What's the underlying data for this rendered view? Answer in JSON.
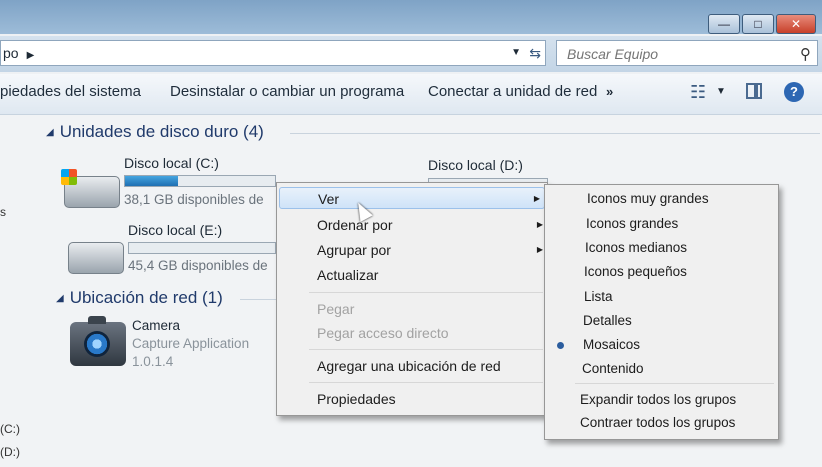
{
  "breadcrumb": {
    "text": "po"
  },
  "search": {
    "placeholder": "Buscar Equipo"
  },
  "toolbar": {
    "items": [
      "piedades del sistema",
      "Desinstalar o cambiar un programa",
      "Conectar a unidad de red"
    ],
    "more": "»"
  },
  "window_buttons": {
    "minimize": "—",
    "maximize": "□",
    "close": "✕"
  },
  "groups": {
    "hard_disks": "Unidades de disco duro (4)",
    "network": "Ubicación de red (1)"
  },
  "drives": [
    {
      "name": "Disco local (C:)",
      "free": "38,1 GB disponibles de",
      "used_fraction": 0.35
    },
    {
      "name": "Disco local (D:)",
      "free": "",
      "used_fraction": 0
    },
    {
      "name": "Disco local (E:)",
      "free": "45,4 GB disponibles de",
      "used_fraction": 0
    }
  ],
  "network_item": {
    "name": "Camera",
    "type": "Capture Application",
    "version": "1.0.1.4"
  },
  "left_stubs": [
    "s",
    "(C:)",
    "(D:)"
  ],
  "context_menu": {
    "items": [
      {
        "label": "Ver",
        "submenu": true,
        "enabled": true,
        "highlighted": true
      },
      {
        "label": "Ordenar por",
        "submenu": true,
        "enabled": true
      },
      {
        "label": "Agrupar por",
        "submenu": true,
        "enabled": true
      },
      {
        "label": "Actualizar",
        "submenu": false,
        "enabled": true
      },
      {
        "label": "Pegar",
        "submenu": false,
        "enabled": false
      },
      {
        "label": "Pegar acceso directo",
        "submenu": false,
        "enabled": false
      },
      {
        "label": "Agregar una ubicación de red",
        "submenu": false,
        "enabled": true
      },
      {
        "label": "Propiedades",
        "submenu": false,
        "enabled": true
      }
    ]
  },
  "view_submenu": {
    "items": [
      {
        "label": "Iconos muy grandes"
      },
      {
        "label": "Iconos grandes"
      },
      {
        "label": "Iconos medianos"
      },
      {
        "label": "Iconos pequeños"
      },
      {
        "label": "Lista"
      },
      {
        "label": "Detalles"
      },
      {
        "label": "Mosaicos",
        "selected": true
      },
      {
        "label": "Contenido"
      },
      {
        "label": "Expandir todos los grupos"
      },
      {
        "label": "Contraer todos los grupos"
      }
    ]
  },
  "colors": {
    "accent": "#2b5d9e",
    "progress": "#1f6fb2",
    "group_header": "#203a6b"
  }
}
